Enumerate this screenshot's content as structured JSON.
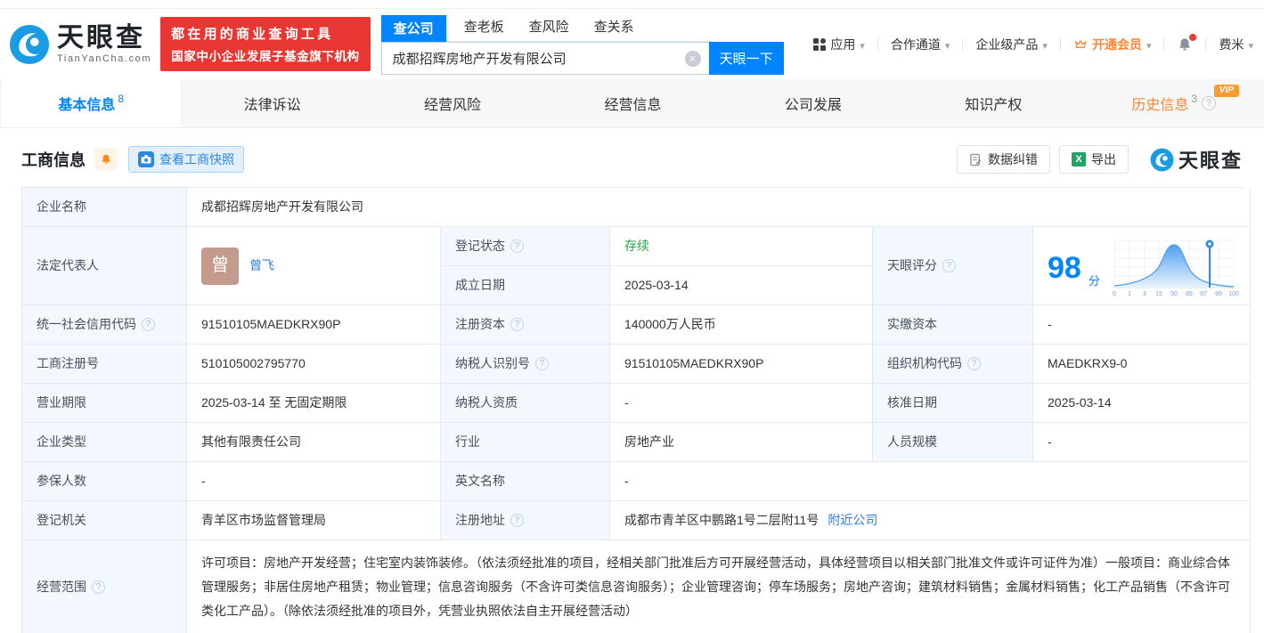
{
  "colors": {
    "primary": "#0084ff",
    "link": "#2e7ce0",
    "green": "#26a248",
    "orange": "#ff8534",
    "red": "#e83632"
  },
  "header": {
    "logo_title": "天眼查",
    "logo_domain": "TianYanCha.com",
    "slogan_line1": "都在用的商业查询工具",
    "slogan_line2": "国家中小企业发展子基金旗下机构",
    "search_tabs": [
      {
        "label": "查公司",
        "active": true
      },
      {
        "label": "查老板",
        "active": false
      },
      {
        "label": "查风险",
        "active": false
      },
      {
        "label": "查关系",
        "active": false
      }
    ],
    "search_value": "成都招辉房地产开发有限公司",
    "search_button": "天眼一下",
    "nav_app": "应用",
    "nav_partner": "合作通道",
    "nav_enterprise": "企业级产品",
    "nav_vip": "开通会员",
    "nav_user": "费米"
  },
  "tabs": {
    "basic": {
      "label": "基本信息",
      "count": "8"
    },
    "legal": {
      "label": "法律诉讼"
    },
    "risk": {
      "label": "经营风险"
    },
    "operation": {
      "label": "经营信息"
    },
    "development": {
      "label": "公司发展"
    },
    "ip": {
      "label": "知识产权"
    },
    "history": {
      "label": "历史信息",
      "count": "3",
      "vip": "VIP"
    }
  },
  "section": {
    "title": "工商信息",
    "snapshot_button": "查看工商快照",
    "correction_button": "数据纠错",
    "export_button": "导出",
    "watermark": "天眼查"
  },
  "fields": {
    "company_name_label": "企业名称",
    "company_name": "成都招辉房地产开发有限公司",
    "legal_rep_label": "法定代表人",
    "avatar_char": "曾",
    "legal_rep_name": "曾飞",
    "reg_status_label": "登记状态",
    "reg_status": "存续",
    "establish_date_label": "成立日期",
    "establish_date": "2025-03-14",
    "score_label": "天眼评分",
    "score_value": "98",
    "score_unit": "分",
    "score_ticks": [
      "0",
      "1",
      "3",
      "15",
      "50",
      "85",
      "97",
      "99",
      "100"
    ],
    "uscc_label": "统一社会信用代码",
    "uscc": "91510105MAEDKRX90P",
    "reg_capital_label": "注册资本",
    "reg_capital": "140000万人民币",
    "paid_capital_label": "实缴资本",
    "paid_capital": "-",
    "reg_number_label": "工商注册号",
    "reg_number": "510105002795770",
    "taxpayer_id_label": "纳税人识别号",
    "taxpayer_id": "91510105MAEDKRX90P",
    "org_code_label": "组织机构代码",
    "org_code": "MAEDKRX9-0",
    "business_term_label": "营业期限",
    "business_term": "2025-03-14 至 无固定期限",
    "taxpayer_quality_label": "纳税人资质",
    "taxpayer_quality": "-",
    "approval_date_label": "核准日期",
    "approval_date": "2025-03-14",
    "company_type_label": "企业类型",
    "company_type": "其他有限责任公司",
    "industry_label": "行业",
    "industry": "房地产业",
    "staff_size_label": "人员规模",
    "staff_size": "-",
    "insured_label": "参保人数",
    "insured": "-",
    "english_name_label": "英文名称",
    "english_name": "-",
    "reg_authority_label": "登记机关",
    "reg_authority": "青羊区市场监督管理局",
    "reg_address_label": "注册地址",
    "reg_address": "成都市青羊区中鹏路1号二层附11号",
    "nearby_link": "附近公司",
    "business_scope_label": "经营范围",
    "business_scope": "许可项目：房地产开发经营；住宅室内装饰装修。（依法须经批准的项目，经相关部门批准后方可开展经营活动，具体经营项目以相关部门批准文件或许可证件为准）一般项目：商业综合体管理服务；非居住房地产租赁；物业管理；信息咨询服务（不含许可类信息咨询服务）；企业管理咨询；停车场服务；房地产咨询；建筑材料销售；金属材料销售；化工产品销售（不含许可类化工产品）。（除依法须经批准的项目外，凭营业执照依法自主开展经营活动）"
  }
}
